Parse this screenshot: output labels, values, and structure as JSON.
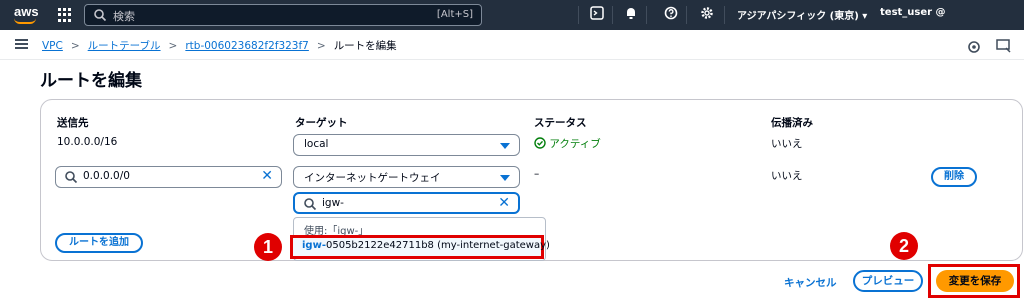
{
  "topnav": {
    "logo_text": "aws",
    "search_placeholder": "検索",
    "search_shortcut": "[Alt+S]",
    "region": "アジアパシフィック (東京) ▾",
    "user": "test_user @"
  },
  "breadcrumb": {
    "items": [
      "VPC",
      "ルートテーブル",
      "rtb-006023682f2f323f7"
    ],
    "current": "ルートを編集"
  },
  "page": {
    "title": "ルートを編集"
  },
  "table": {
    "headers": {
      "destination": "送信先",
      "target": "ターゲット",
      "status": "ステータス",
      "propagated": "伝播済み"
    },
    "rows": [
      {
        "destination": "10.0.0.0/16",
        "target": "local",
        "status": "アクティブ",
        "propagated": "いいえ"
      },
      {
        "destination": "0.0.0.0/0",
        "target": "インターネットゲートウェイ",
        "status": "–",
        "propagated": "いいえ",
        "remove_label": "削除"
      }
    ],
    "target_filter": "igw-",
    "dropdown": {
      "group_label": "使用:「igw-」",
      "option_match": "igw-",
      "option_rest": "0505b2122e42711b8 (my-internet-gateway)"
    },
    "add_route_label": "ルートを追加"
  },
  "footer": {
    "cancel": "キャンセル",
    "preview": "プレビュー",
    "save": "変更を保存"
  },
  "annotations": {
    "step1": "1",
    "step2": "2"
  }
}
